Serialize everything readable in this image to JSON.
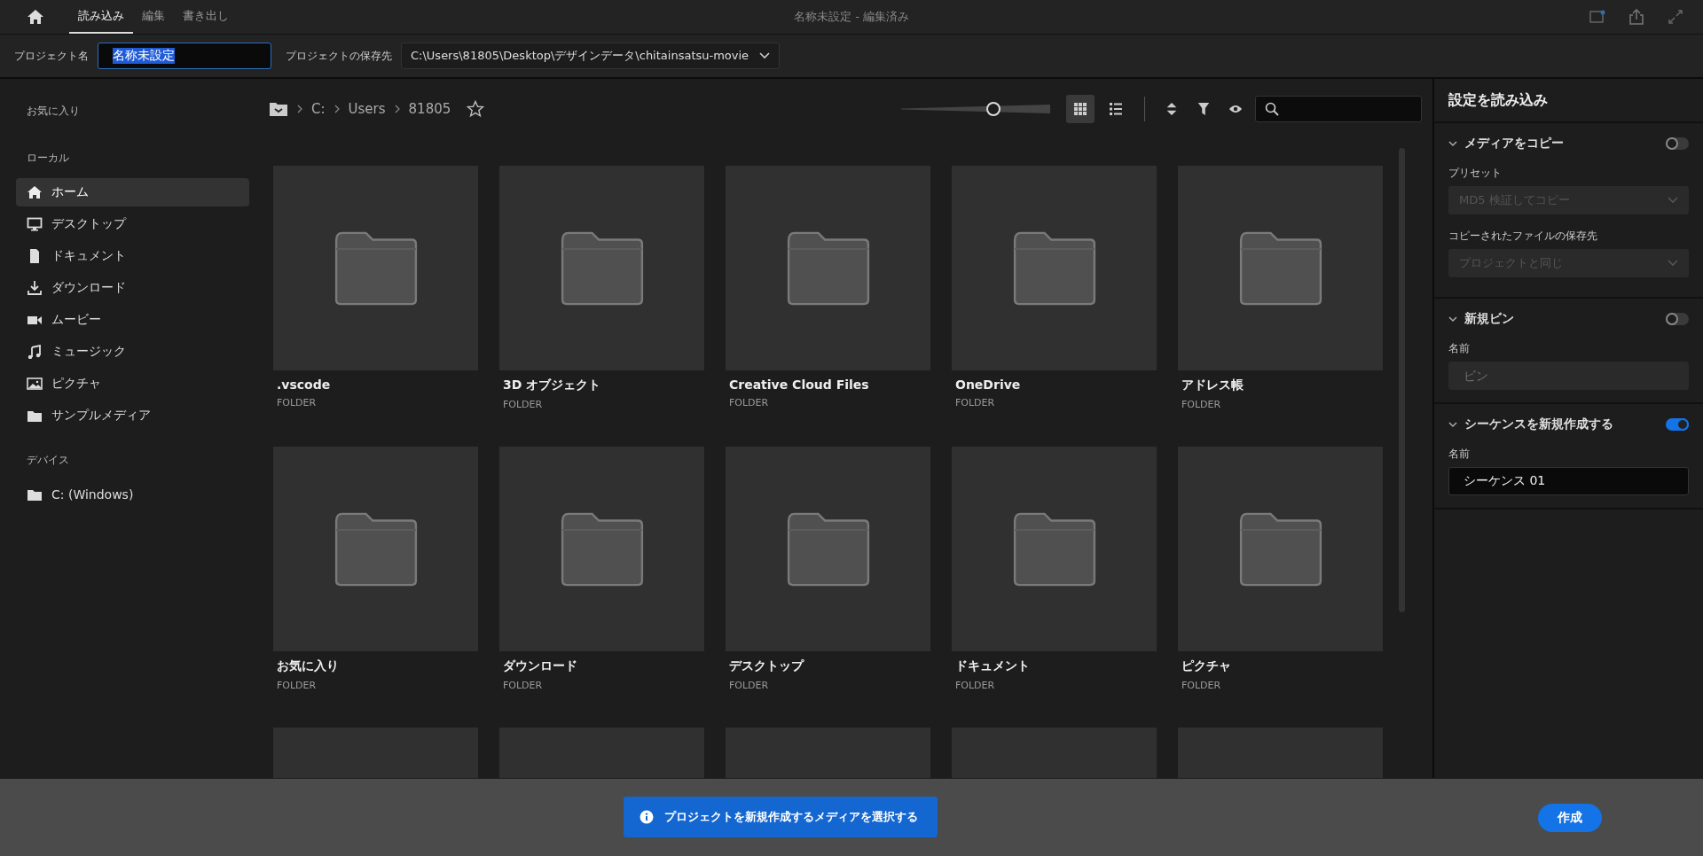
{
  "topbar": {
    "tabs": [
      {
        "label": "読み込み",
        "selected": true
      },
      {
        "label": "編集",
        "selected": false
      },
      {
        "label": "書き出し",
        "selected": false
      }
    ],
    "title": "名称未設定 - 編集済み"
  },
  "project_bar": {
    "name_label": "プロジェクト名",
    "name_value": "名称未設定",
    "location_label": "プロジェクトの保存先",
    "location_value": "C:\\Users\\81805\\Desktop\\デザインデータ\\chitainsatsu-movie"
  },
  "sidebar": {
    "sections": [
      {
        "title": "お気に入り"
      },
      {
        "title": "ローカル",
        "items": [
          {
            "label": "ホーム",
            "kind": "home",
            "selected": true
          },
          {
            "label": "デスクトップ",
            "kind": "desktop",
            "selected": false
          },
          {
            "label": "ドキュメント",
            "kind": "document",
            "selected": false
          },
          {
            "label": "ダウンロード",
            "kind": "download",
            "selected": false
          },
          {
            "label": "ムービー",
            "kind": "movie",
            "selected": false
          },
          {
            "label": "ミュージック",
            "kind": "music",
            "selected": false
          },
          {
            "label": "ピクチャ",
            "kind": "picture",
            "selected": false
          },
          {
            "label": "サンプルメディア",
            "kind": "folder",
            "selected": false
          }
        ]
      },
      {
        "title": "デバイス",
        "items": [
          {
            "label": "C: (Windows)",
            "kind": "folder",
            "selected": false
          }
        ]
      }
    ]
  },
  "browser": {
    "breadcrumb": [
      "C:",
      "Users",
      "81805"
    ],
    "thumb_size": {
      "level": 0.62
    },
    "views": [
      {
        "kind": "grid",
        "selected": true
      },
      {
        "kind": "list",
        "selected": false
      }
    ],
    "items": [
      {
        "name": ".vscode",
        "type": "FOLDER"
      },
      {
        "name": "3D オブジェクト",
        "type": "FOLDER"
      },
      {
        "name": "Creative Cloud Files",
        "type": "FOLDER"
      },
      {
        "name": "OneDrive",
        "type": "FOLDER"
      },
      {
        "name": "アドレス帳",
        "type": "FOLDER"
      },
      {
        "name": "お気に入り",
        "type": "FOLDER"
      },
      {
        "name": "ダウンロード",
        "type": "FOLDER"
      },
      {
        "name": "デスクトップ",
        "type": "FOLDER"
      },
      {
        "name": "ドキュメント",
        "type": "FOLDER"
      },
      {
        "name": "ピクチャ",
        "type": "FOLDER"
      },
      {
        "kind": "folder"
      },
      {
        "kind": "folder"
      },
      {
        "kind": "folder"
      },
      {
        "kind": "folder"
      },
      {
        "kind": "folder"
      }
    ]
  },
  "settings": {
    "title": "設定を読み込み",
    "sections": [
      {
        "title": "メディアをコピー",
        "on": false,
        "fields": [
          {
            "label": "プリセット",
            "kind": "dropdown",
            "value": "MD5 検証してコピー",
            "disabled": true
          },
          {
            "label": "コピーされたファイルの保存先",
            "kind": "dropdown",
            "value": "プロジェクトと同じ",
            "disabled": true
          }
        ]
      },
      {
        "title": "新規ビン",
        "on": false,
        "fields": [
          {
            "label": "名前",
            "kind": "text",
            "placeholder": "ビン",
            "disabled": true
          }
        ]
      },
      {
        "title": "シーケンスを新規作成する",
        "on": true,
        "fields": [
          {
            "label": "名前",
            "kind": "text",
            "value": "シーケンス 01",
            "disabled": false
          }
        ]
      }
    ]
  },
  "footer": {
    "notice": "プロジェクトを新規作成するメディアを選択する",
    "create_button": "作成"
  }
}
